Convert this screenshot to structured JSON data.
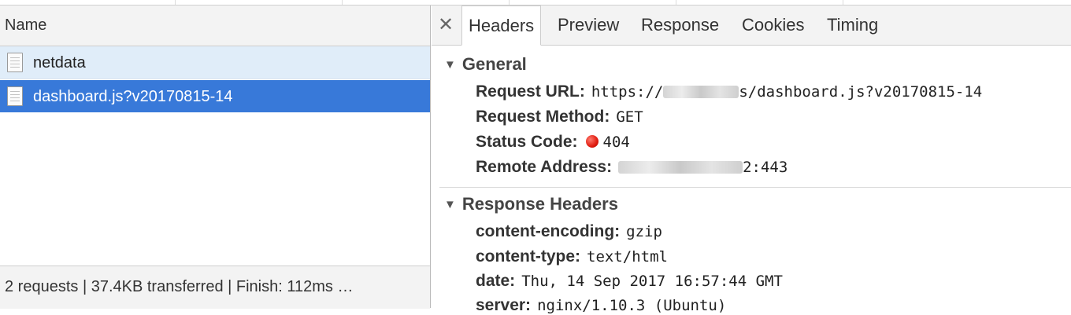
{
  "left": {
    "column_header": "Name",
    "requests": [
      {
        "name": "netdata",
        "icon": "file-icon",
        "selected": false
      },
      {
        "name": "dashboard.js?v20170815-14",
        "icon": "file-icon",
        "selected": true
      }
    ],
    "status": "2 requests | 37.4KB transferred | Finish: 112ms …"
  },
  "right": {
    "close_icon": "✕",
    "tabs": [
      "Headers",
      "Preview",
      "Response",
      "Cookies",
      "Timing"
    ],
    "active_tab": "Headers",
    "general": {
      "title": "General",
      "request_url_key": "Request URL:",
      "request_url_prefix": "https://",
      "request_url_suffix": "s/dashboard.js?v20170815-14",
      "request_method_key": "Request Method:",
      "request_method": "GET",
      "status_code_key": "Status Code:",
      "status_code": "404",
      "remote_address_key": "Remote Address:",
      "remote_address_suffix": "2:443"
    },
    "response_headers": {
      "title": "Response Headers",
      "rows": [
        {
          "key": "content-encoding:",
          "value": "gzip"
        },
        {
          "key": "content-type:",
          "value": "text/html"
        },
        {
          "key": "date:",
          "value": "Thu, 14 Sep 2017 16:57:44 GMT"
        },
        {
          "key": "server:",
          "value": "nginx/1.10.3 (Ubuntu)"
        }
      ]
    }
  },
  "colors": {
    "selected_row": "#3879d9",
    "hover_row": "#e0edf9",
    "status_error": "#e01b0f"
  }
}
